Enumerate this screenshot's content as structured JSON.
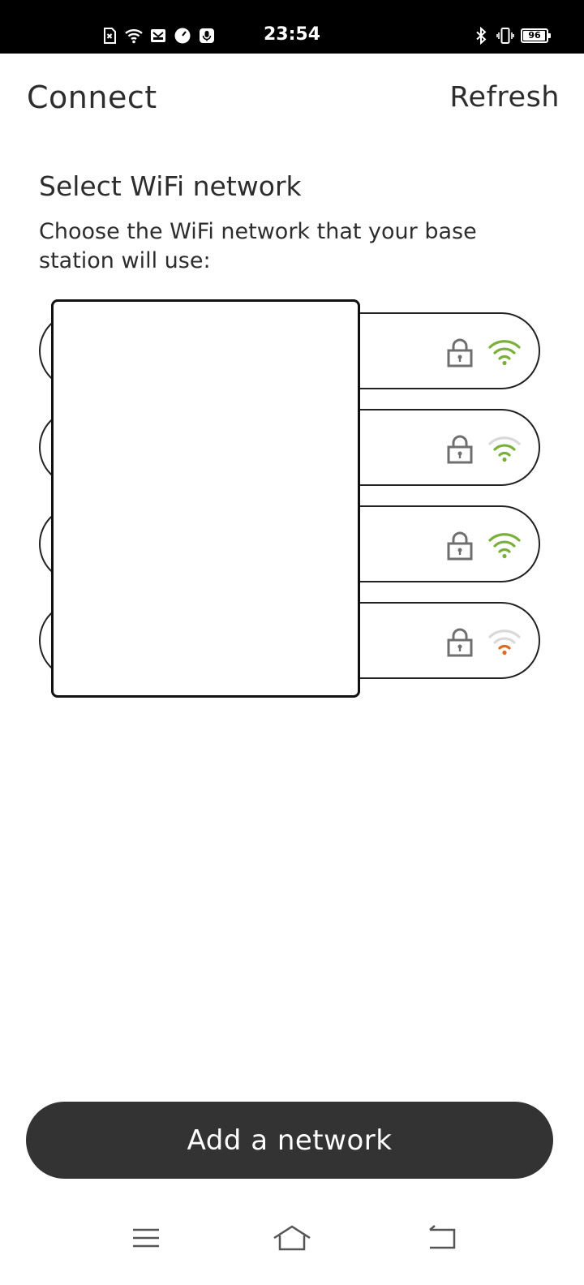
{
  "status_bar": {
    "time": "23:54",
    "battery": "96",
    "icons_left": [
      "sim-x-icon",
      "wifi-status-icon",
      "mail-icon",
      "timer-icon",
      "mic-icon"
    ],
    "icons_right": [
      "bluetooth-icon",
      "vibrate-icon",
      "battery-icon"
    ]
  },
  "header": {
    "title": "Connect",
    "refresh_label": "Refresh"
  },
  "section": {
    "title": "Select WiFi network",
    "description": "Choose the WiFi network that your base station will use:"
  },
  "networks": [
    {
      "name": "",
      "secured": true,
      "signal_bars": 3,
      "signal_color": "#7ab03a"
    },
    {
      "name": "",
      "secured": true,
      "signal_bars": 2,
      "signal_color": "#7ab03a"
    },
    {
      "name": "",
      "secured": true,
      "signal_bars": 3,
      "signal_color": "#7ab03a"
    },
    {
      "name": "",
      "secured": true,
      "signal_bars": 1,
      "signal_color": "#e06a1e"
    }
  ],
  "add_button_label": "Add a network",
  "colors": {
    "button_bg": "#333333",
    "signal_good": "#7ab03a",
    "signal_weak": "#e06a1e",
    "signal_inactive": "#d9d9d9",
    "lock": "#6f6f6f"
  },
  "nav": [
    "menu-icon",
    "home-icon",
    "back-icon"
  ]
}
